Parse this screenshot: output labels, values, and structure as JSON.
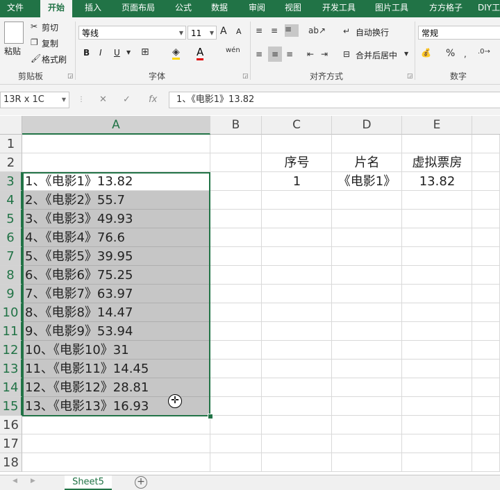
{
  "ribbon_tabs": [
    "文件",
    "开始",
    "插入",
    "页面布局",
    "公式",
    "数据",
    "审阅",
    "视图",
    "开发工具",
    "图片工具",
    "方方格子",
    "DIY工具箱"
  ],
  "active_tab": "开始",
  "clipboard": {
    "paste": "粘贴",
    "cut": "剪切",
    "copy": "复制",
    "format_painter": "格式刷",
    "group": "剪贴板"
  },
  "font": {
    "name": "等线",
    "size": "11",
    "group": "字体",
    "bold": "B",
    "italic": "I",
    "underline": "U",
    "grow": "A",
    "shrink": "A"
  },
  "alignment": {
    "wrap": "自动换行",
    "merge": "合并后居中",
    "group": "对齐方式"
  },
  "number": {
    "format": "常规",
    "group": "数字",
    "percent": "%"
  },
  "formula_bar": {
    "name_box": "13R x 1C",
    "formula": "1、《电影1》13.82",
    "fx": "fx"
  },
  "columns": [
    "A",
    "B",
    "C",
    "D",
    "E"
  ],
  "rows": [
    "1",
    "2",
    "3",
    "4",
    "5",
    "6",
    "7",
    "8",
    "9",
    "10",
    "11",
    "12",
    "13",
    "14",
    "15",
    "16",
    "17",
    "18"
  ],
  "column_a": [
    "",
    "",
    "1、《电影1》13.82",
    "2、《电影2》55.7",
    "3、《电影3》49.93",
    "4、《电影4》76.6",
    "5、《电影5》39.95",
    "6、《电影6》75.25",
    "7、《电影7》63.97",
    "8、《电影8》14.47",
    "9、《电影9》53.94",
    "10、《电影10》31",
    "11、《电影11》14.45",
    "12、《电影12》28.81",
    "13、《电影13》16.93",
    "",
    "",
    ""
  ],
  "table_header": {
    "c": "序号",
    "d": "片名",
    "e": "虚拟票房"
  },
  "table_row1": {
    "c": "1",
    "d": "《电影1》",
    "e": "13.82"
  },
  "sheet": {
    "name": "Sheet5",
    "add": "+"
  },
  "colors": {
    "accent": "#217346",
    "selection": "#c6c6c6"
  }
}
